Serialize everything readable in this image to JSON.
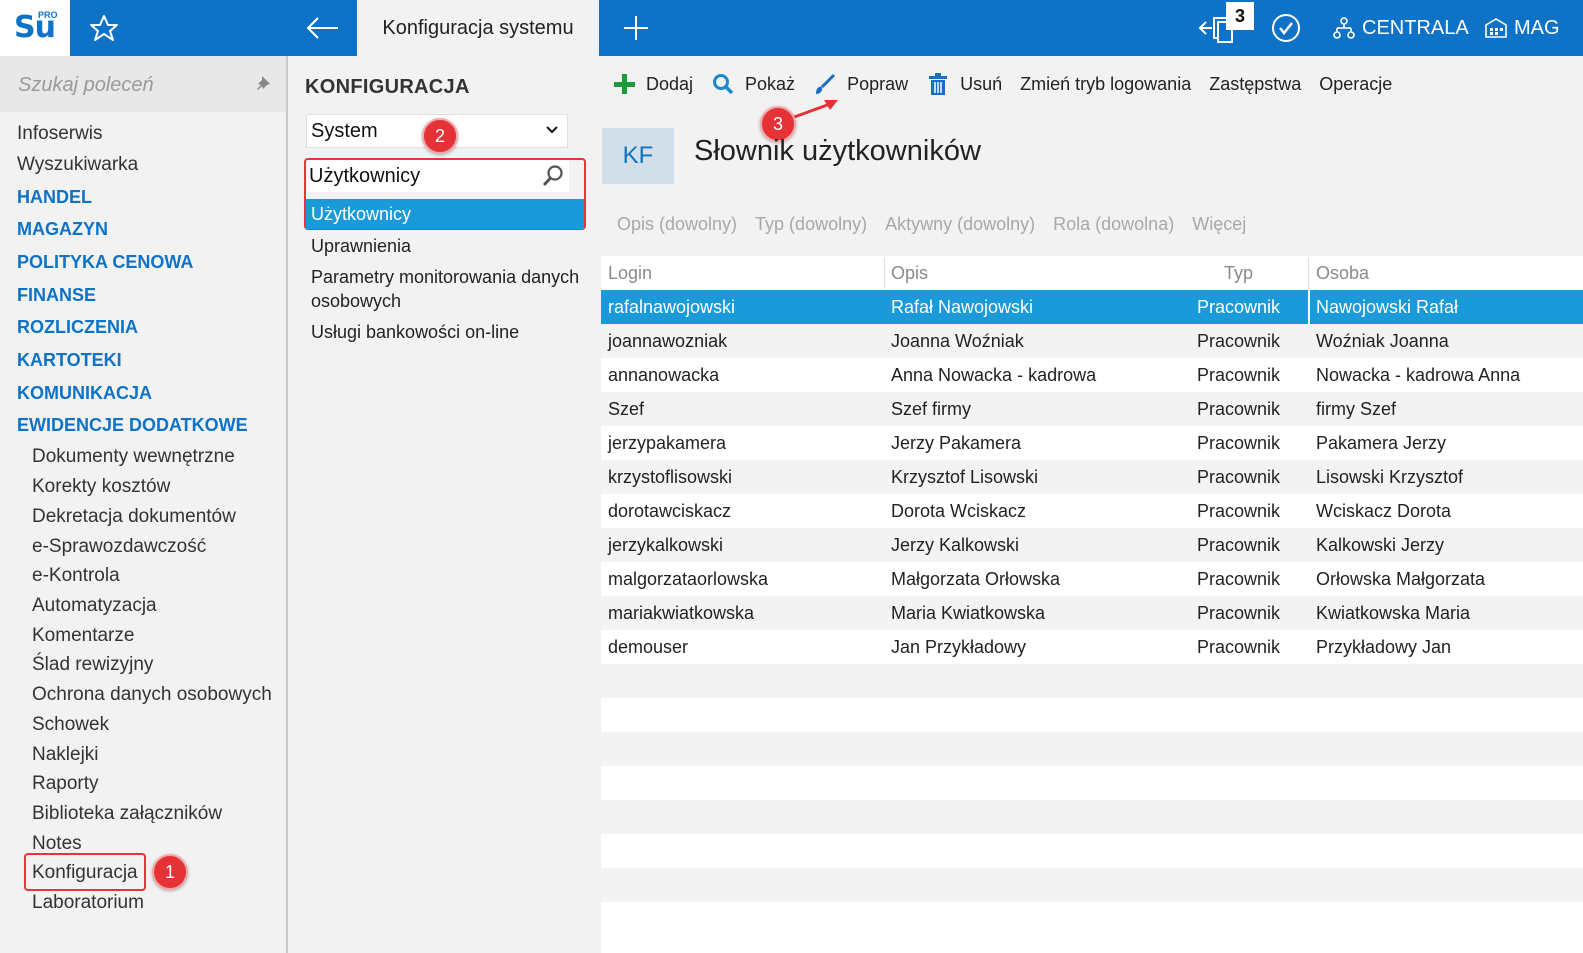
{
  "topbar": {
    "logo_main": "Su",
    "logo_sup": "PRO",
    "active_tab": "Konfiguracja systemu",
    "notifications_count": "3",
    "centrala_label": "CENTRALA",
    "mag_label": "MAG"
  },
  "sidebar": {
    "search_placeholder": "Szukaj poleceń",
    "plain_items": [
      "Infoserwis",
      "Wyszukiwarka"
    ],
    "sections": [
      "HANDEL",
      "MAGAZYN",
      "POLITYKA CENOWA",
      "FINANSE",
      "ROZLICZENIA",
      "KARTOTEKI",
      "KOMUNIKACJA",
      "EWIDENCJE DODATKOWE"
    ],
    "subitems": [
      "Dokumenty wewnętrzne",
      "Korekty kosztów",
      "Dekretacja dokumentów",
      "e-Sprawozdawczość",
      "e-Kontrola",
      "Automatyzacja",
      "Komentarze",
      "Ślad rewizyjny",
      "Ochrona danych osobowych",
      "Schowek",
      "Naklejki",
      "Raporty",
      "Biblioteka załączników",
      "Notes",
      "Konfiguracja",
      "Laboratorium"
    ]
  },
  "callouts": [
    "1",
    "2",
    "3"
  ],
  "config": {
    "title": "KONFIGURACJA",
    "selected_group": "System",
    "filter_value": "Użytkownicy",
    "selected_item": "Użytkownicy",
    "items": [
      "Uprawnienia",
      "Parametry monitorowania danych osobowych",
      "Usługi bankowości on-line"
    ]
  },
  "toolbar": {
    "add": "Dodaj",
    "show": "Pokaż",
    "edit": "Popraw",
    "delete": "Usuń",
    "login_mode": "Zmień tryb logowania",
    "substitutions": "Zastępstwa",
    "operations": "Operacje"
  },
  "dictionary": {
    "badge": "KF",
    "title": "Słownik użytkowników",
    "filters": [
      "Opis (dowolny)",
      "Typ (dowolny)",
      "Aktywny (dowolny)",
      "Rola (dowolna)",
      "Więcej"
    ],
    "columns": [
      "Login",
      "Opis",
      "Typ",
      "Osoba"
    ],
    "rows": [
      {
        "login": "rafalnawojowski",
        "opis": "Rafał Nawojowski",
        "typ": "Pracownik",
        "osoba": "Nawojowski Rafał"
      },
      {
        "login": "joannawozniak",
        "opis": "Joanna Woźniak",
        "typ": "Pracownik",
        "osoba": "Woźniak Joanna"
      },
      {
        "login": "annanowacka",
        "opis": "Anna Nowacka - kadrowa",
        "typ": "Pracownik",
        "osoba": "Nowacka - kadrowa Anna"
      },
      {
        "login": "Szef",
        "opis": "Szef firmy",
        "typ": "Pracownik",
        "osoba": "firmy Szef"
      },
      {
        "login": "jerzypakamera",
        "opis": "Jerzy Pakamera",
        "typ": "Pracownik",
        "osoba": "Pakamera Jerzy"
      },
      {
        "login": "krzystoflisowski",
        "opis": "Krzysztof Lisowski",
        "typ": "Pracownik",
        "osoba": "Lisowski Krzysztof"
      },
      {
        "login": "dorotawciskacz",
        "opis": "Dorota Wciskacz",
        "typ": "Pracownik",
        "osoba": "Wciskacz Dorota"
      },
      {
        "login": "jerzykalkowski",
        "opis": "Jerzy Kalkowski",
        "typ": "Pracownik",
        "osoba": "Kalkowski Jerzy"
      },
      {
        "login": "malgorzataorlowska",
        "opis": "Małgorzata Orłowska",
        "typ": "Pracownik",
        "osoba": "Orłowska Małgorzata"
      },
      {
        "login": "mariakwiatkowska",
        "opis": "Maria Kwiatkowska",
        "typ": "Pracownik",
        "osoba": "Kwiatkowska Maria"
      },
      {
        "login": "demouser",
        "opis": "Jan Przykładowy",
        "typ": "Pracownik",
        "osoba": "Przykładowy Jan"
      }
    ]
  },
  "colors": {
    "brand_blue": "#0e73c7",
    "selection_blue": "#1a9ad9",
    "callout_red": "#e43237"
  }
}
